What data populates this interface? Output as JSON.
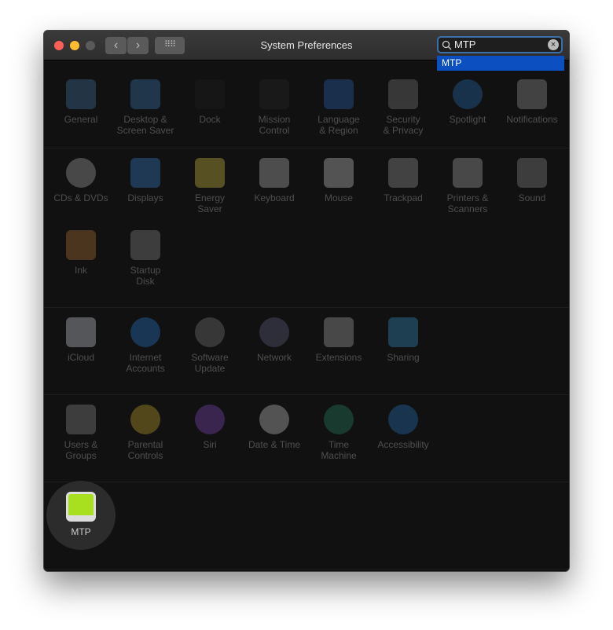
{
  "window": {
    "title": "System Preferences"
  },
  "search": {
    "value": "MTP",
    "suggestion": "MTP"
  },
  "sections": [
    [
      {
        "label": "General",
        "icon": "general-icon",
        "color": "#4a7fb5"
      },
      {
        "label": "Desktop &\nScreen Saver",
        "icon": "desktop-icon",
        "color": "#3f86c6"
      },
      {
        "label": "Dock",
        "icon": "dock-icon",
        "color": "#222"
      },
      {
        "label": "Mission\nControl",
        "icon": "mission-control-icon",
        "color": "#2a2a2a"
      },
      {
        "label": "Language\n& Region",
        "icon": "flag-icon",
        "color": "#2a6fc9"
      },
      {
        "label": "Security\n& Privacy",
        "icon": "house-lock-icon",
        "color": "#8a8a8a"
      },
      {
        "label": "Spotlight",
        "icon": "magnifier-icon",
        "color": "#2a78c6"
      },
      {
        "label": "Notifications",
        "icon": "notifications-icon",
        "color": "#aaa"
      }
    ],
    [
      {
        "label": "CDs & DVDs",
        "icon": "disc-icon",
        "color": "#bbb"
      },
      {
        "label": "Displays",
        "icon": "display-icon",
        "color": "#3e8fe0"
      },
      {
        "label": "Energy\nSaver",
        "icon": "lightbulb-icon",
        "color": "#e8d44a"
      },
      {
        "label": "Keyboard",
        "icon": "keyboard-icon",
        "color": "#ccc"
      },
      {
        "label": "Mouse",
        "icon": "mouse-icon",
        "color": "#ddd"
      },
      {
        "label": "Trackpad",
        "icon": "trackpad-icon",
        "color": "#aaa"
      },
      {
        "label": "Printers &\nScanners",
        "icon": "printer-icon",
        "color": "#bbb"
      },
      {
        "label": "Sound",
        "icon": "speaker-icon",
        "color": "#999"
      },
      {
        "label": "Ink",
        "icon": "ink-icon",
        "color": "#c9813a"
      },
      {
        "label": "Startup\nDisk",
        "icon": "hard-disk-icon",
        "color": "#999"
      }
    ],
    [
      {
        "label": "iCloud",
        "icon": "icloud-icon",
        "color": "#e0e8f0"
      },
      {
        "label": "Internet\nAccounts",
        "icon": "at-sign-icon",
        "color": "#2a86e0"
      },
      {
        "label": "Software\nUpdate",
        "icon": "gear-icon",
        "color": "#888"
      },
      {
        "label": "Network",
        "icon": "globe-icon",
        "color": "#6c6c90"
      },
      {
        "label": "Extensions",
        "icon": "puzzle-icon",
        "color": "#bbb"
      },
      {
        "label": "Sharing",
        "icon": "folder-icon",
        "color": "#3aa0d8"
      }
    ],
    [
      {
        "label": "Users &\nGroups",
        "icon": "users-icon",
        "color": "#999"
      },
      {
        "label": "Parental\nControls",
        "icon": "parental-icon",
        "color": "#d8b830"
      },
      {
        "label": "Siri",
        "icon": "siri-icon",
        "color": "#9050d0"
      },
      {
        "label": "Date & Time",
        "icon": "clock-icon",
        "color": "#ddd"
      },
      {
        "label": "Time\nMachine",
        "icon": "time-machine-icon",
        "color": "#2a9070"
      },
      {
        "label": "Accessibility",
        "icon": "accessibility-icon",
        "color": "#2a80d0"
      }
    ],
    [
      {
        "label": "MTP",
        "icon": "android-drive-icon",
        "color": "#a8e020",
        "highlighted": true
      }
    ]
  ]
}
